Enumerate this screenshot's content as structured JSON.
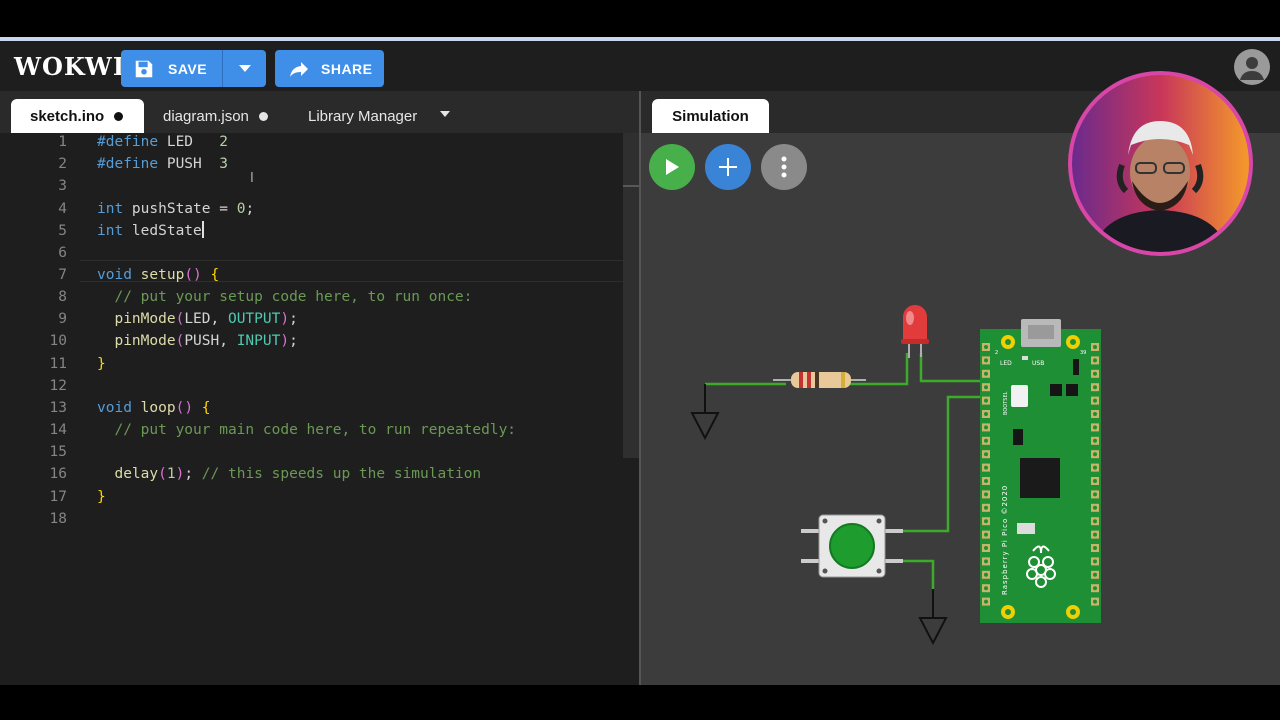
{
  "header": {
    "logo": "WOKWI",
    "save_label": "SAVE",
    "share_label": "SHARE"
  },
  "editor": {
    "tabs": [
      {
        "label": "sketch.ino",
        "modified": true,
        "active": true
      },
      {
        "label": "diagram.json",
        "modified": true,
        "active": false
      },
      {
        "label": "Library Manager",
        "active": false
      }
    ],
    "line_numbers": [
      "1",
      "2",
      "3",
      "4",
      "5",
      "6",
      "7",
      "8",
      "9",
      "10",
      "11",
      "12",
      "13",
      "14",
      "15",
      "16",
      "17",
      "18"
    ],
    "code": [
      "#define LED   2",
      "#define PUSH  3",
      "",
      "int pushState = 0;",
      "int ledState",
      "",
      "void setup() {",
      "  // put your setup code here, to run once:",
      "  pinMode(LED, OUTPUT);",
      "  pinMode(PUSH, INPUT);",
      "}",
      "",
      "void loop() {",
      "  // put your main code here, to run repeatedly:",
      "",
      "  delay(1); // this speeds up the simulation",
      "}",
      ""
    ],
    "active_line": 5
  },
  "simulation": {
    "tab_label": "Simulation",
    "board_labels": {
      "pin2": "2",
      "pin39": "39",
      "led": "LED",
      "usb": "USB",
      "bootsel": "BOOTSEL",
      "model": "Raspberry Pi Pico ©2020"
    }
  },
  "colors": {
    "accent": "#3f8ee8",
    "play": "#47b04b",
    "add": "#3a84d8",
    "more": "#8a8a8a",
    "board": "#1f8f35",
    "wire": "#3dab2a",
    "led": "#e23b3b"
  }
}
